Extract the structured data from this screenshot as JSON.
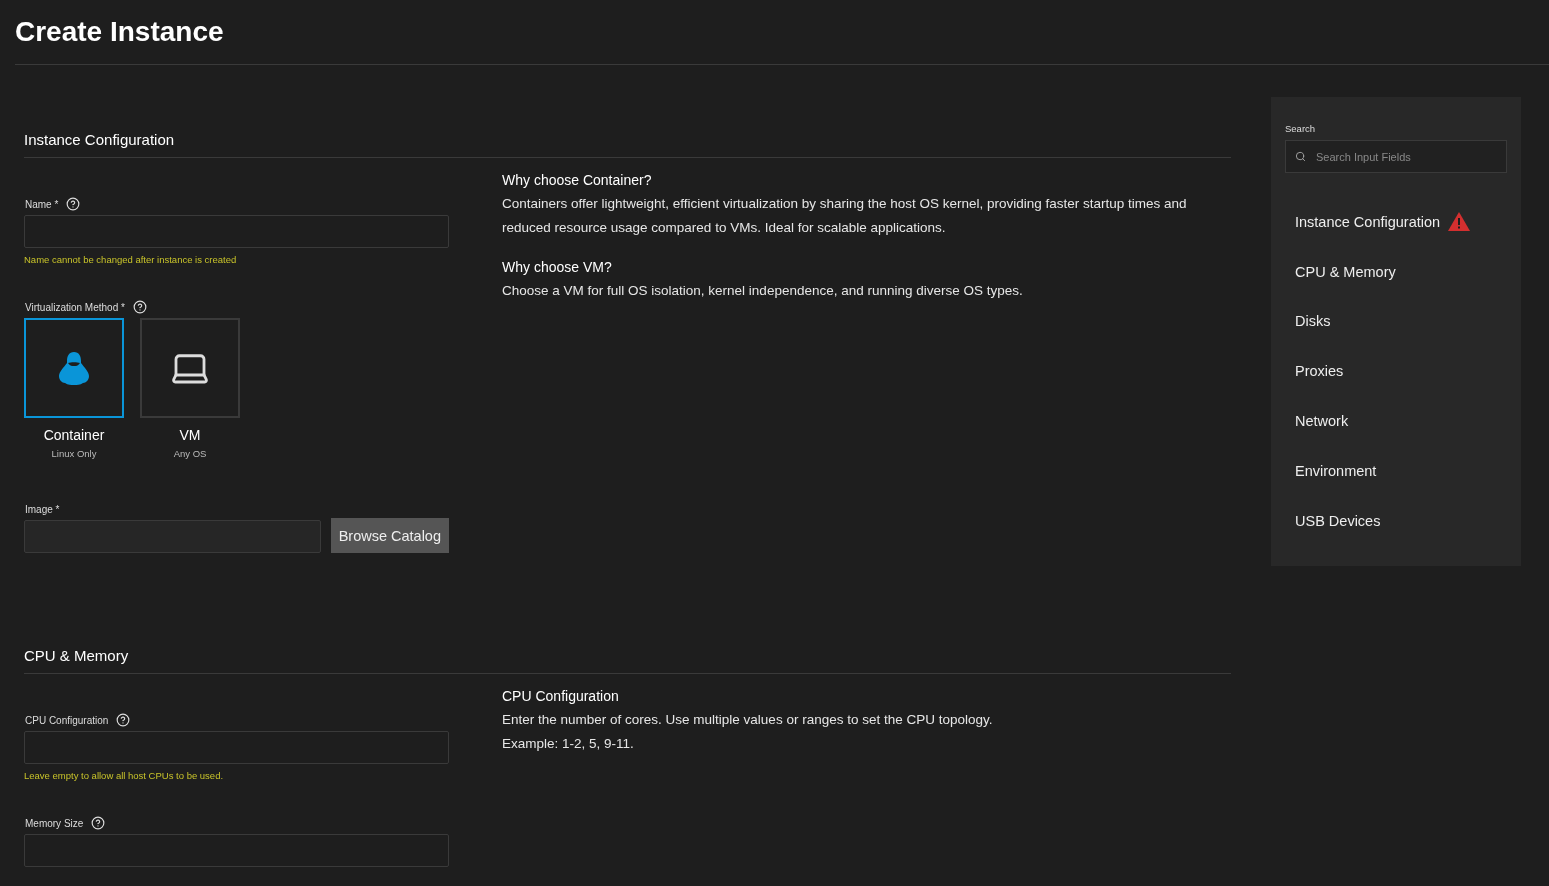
{
  "title": "Create Instance",
  "sections": [
    {
      "title": "Instance Configuration",
      "fields": [
        {
          "kind": "text",
          "label": "Name *",
          "hint": "Name cannot be changed after instance is created"
        },
        {
          "kind": "choice",
          "label": "Virtualization Method *",
          "options": [
            {
              "name": "Container",
              "note": "Linux Only",
              "selected": true
            },
            {
              "name": "VM",
              "note": "Any OS",
              "selected": false
            }
          ]
        },
        {
          "kind": "image",
          "label": "Image *",
          "button": "Browse Catalog"
        }
      ],
      "help": [
        {
          "heading": "Why choose Container?",
          "text": "Containers offer lightweight, efficient virtualization by sharing the host OS kernel, providing faster startup times and reduced resource usage compared to VMs. Ideal for scalable applications."
        },
        {
          "heading": "Why choose VM?",
          "text": "Choose a VM for full OS isolation, kernel independence, and running diverse OS types."
        }
      ]
    },
    {
      "title": "CPU & Memory",
      "fields": [
        {
          "kind": "text",
          "label": "CPU Configuration",
          "hint": "Leave empty to allow all host CPUs to be used."
        },
        {
          "kind": "text",
          "label": "Memory Size"
        }
      ],
      "help": [
        {
          "heading": "CPU Configuration",
          "text": "Enter the number of cores. Use multiple values or ranges to set the CPU topology.\nExample: 1-2, 5, 9-11."
        }
      ]
    }
  ],
  "sidebar": {
    "search_label": "Search",
    "search_placeholder": "Search Input Fields",
    "items": [
      {
        "label": "Instance Configuration",
        "warning": true
      },
      {
        "label": "CPU & Memory",
        "warning": false
      },
      {
        "label": "Disks",
        "warning": false
      },
      {
        "label": "Proxies",
        "warning": false
      },
      {
        "label": "Network",
        "warning": false
      },
      {
        "label": "Environment",
        "warning": false
      },
      {
        "label": "USB Devices",
        "warning": false
      }
    ]
  }
}
